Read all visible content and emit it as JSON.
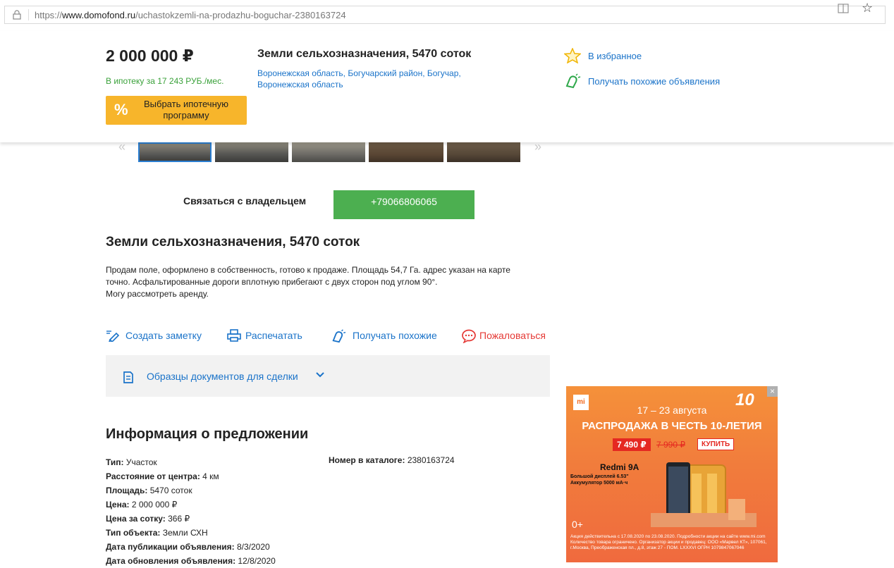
{
  "browser": {
    "url_prefix": "https://",
    "url_host": "www.domofond.ru",
    "url_path": "/uchastokzemli-na-prodazhu-boguchar-2380163724"
  },
  "header": {
    "price": "2 000 000 ₽",
    "mortgage": "В ипотеку за 17 243 РУБ./мес.",
    "mortgage_button": "Выбрать ипотечную программу",
    "mortgage_icon": "%",
    "title": "Земли сельхозназначения, 5470 соток",
    "address": "Воронежская область, Богучарский район, Богучар, Воронежская область",
    "favorite": "В избранное",
    "similar": "Получать похожие объявления"
  },
  "contact": {
    "label": "Связаться с владельцем",
    "phone": "+79066806065"
  },
  "listing": {
    "title": "Земли сельхозназначения, 5470 соток",
    "description": [
      "Продам поле, оформлено в собственность, готово к продаже. Площадь 54,7 Га. адрес указан на карте",
      "точно. Асфальтированные дороги вплотную прибегают с двух сторон под углом 90°.",
      "Могу рассмотреть аренду."
    ]
  },
  "actions": {
    "note": "Создать заметку",
    "print": "Распечатать",
    "similar": "Получать похожие",
    "report": "Пожаловаться"
  },
  "docs": {
    "label": "Образцы документов для сделки"
  },
  "info": {
    "title": "Информация о предложении",
    "rows": [
      {
        "key": "Тип:",
        "value": "Участок"
      },
      {
        "key": "Расстояние от центра:",
        "value": "4 км"
      },
      {
        "key": "Площадь:",
        "value": "5470 соток"
      },
      {
        "key": "Цена:",
        "value": "2 000 000 ₽"
      },
      {
        "key": "Цена за сотку:",
        "value": "366 ₽"
      },
      {
        "key": "Тип объекта:",
        "value": "Земли СХН"
      },
      {
        "key": "Дата публикации объявления:",
        "value": "8/3/2020"
      },
      {
        "key": "Дата обновления объявления:",
        "value": "12/8/2020"
      }
    ],
    "catalog_key": "Номер в каталоге:",
    "catalog_value": "2380163724"
  },
  "ad": {
    "logo": "mi",
    "anniversary": "10",
    "dates": "17 – 23 августа",
    "headline": "РАСПРОДАЖА В ЧЕСТЬ 10-ЛЕТИЯ",
    "new_price": "7 490 ₽",
    "old_price": "7 990 ₽",
    "buy": "КУПИТЬ",
    "model": "Redmi 9A",
    "spec1": "Большой дисплей 6.53\"",
    "spec2": "Аккумулятор 5000 мА·ч",
    "age": "0+",
    "legal": "Акция действительна с 17.08.2020 по 23.08.2020. Подробности акции на сайте www.mi.com Количество товара ограничено. Организатор акции и продавец: ООО «Марвел КТ», 107061, г.Москва, Преображенская пл., д.8, этаж 27 - ПОМ. LXXXVI ОГРН 1079847067046",
    "close": "×"
  },
  "colors": {
    "link": "#1a73c9",
    "green": "#3aa13a",
    "phone_button": "#4caf50",
    "mortgage_button": "#f7b52b",
    "report": "#e53935",
    "ad": "#f17c3c"
  }
}
